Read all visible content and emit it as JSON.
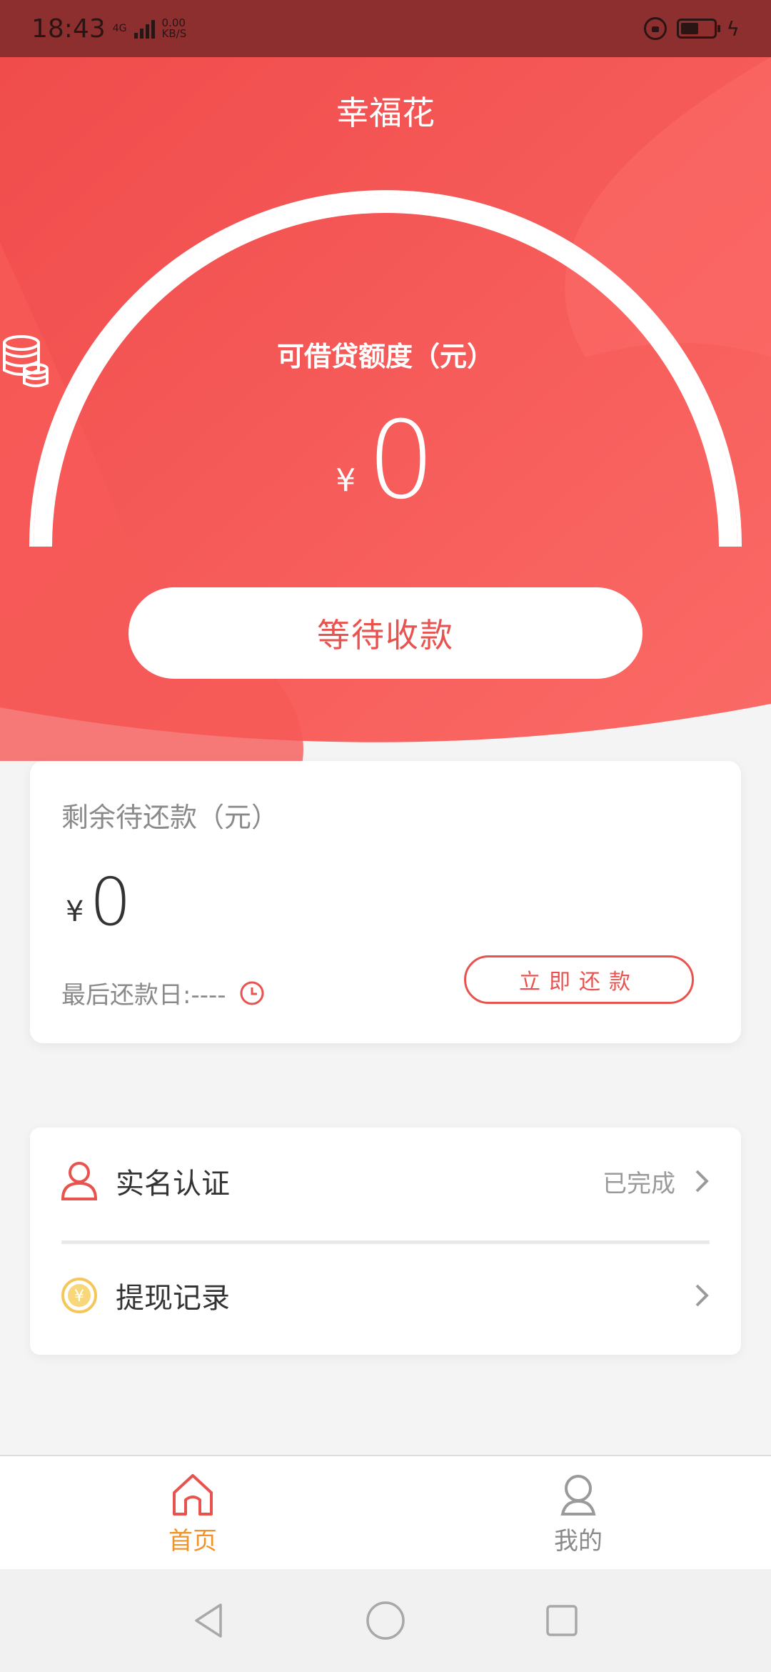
{
  "status_bar": {
    "time": "18:43",
    "network": "4G",
    "speed_value": "0.00",
    "speed_unit": "KB/S"
  },
  "app": {
    "title": "幸福花"
  },
  "credit": {
    "label": "可借贷额度（元）",
    "currency": "¥",
    "amount": "0",
    "button_label": "等待收款"
  },
  "repayment": {
    "title": "剩余待还款（元）",
    "currency": "¥",
    "amount": "0",
    "due_label": "最后还款日:----",
    "button_label": "立即还款"
  },
  "menu": {
    "items": [
      {
        "label": "实名认证",
        "status": "已完成"
      },
      {
        "label": "提现记录",
        "status": ""
      }
    ]
  },
  "bottom_nav": {
    "items": [
      {
        "label": "首页",
        "active": true
      },
      {
        "label": "我的",
        "active": false
      }
    ]
  },
  "colors": {
    "primary": "#e8534f",
    "active_tab": "#f0932b",
    "status_bar": "#8e2f2f"
  }
}
